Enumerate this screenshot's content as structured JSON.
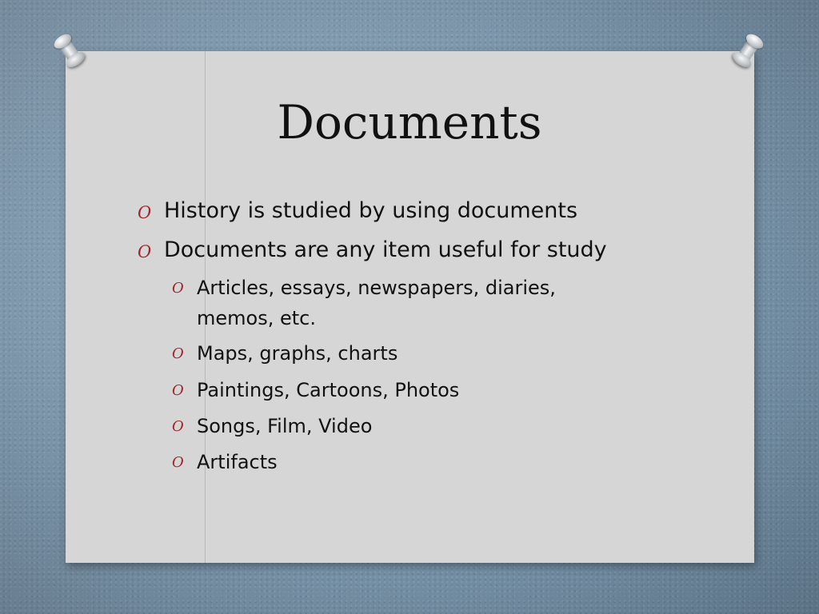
{
  "slide": {
    "title": "Documents",
    "bullets": [
      "History is studied by using documents",
      "Documents are any item useful for study"
    ],
    "sub_bullets": [
      [
        "Articles, essays, newspapers, diaries,",
        "memos, etc."
      ],
      "Maps, graphs, charts",
      "Paintings, Cartoons, Photos",
      "Songs, Film, Video",
      "Artifacts"
    ],
    "marker": "O"
  },
  "colors": {
    "background": "#7d98ae",
    "card": "#d6d6d6",
    "marker": "#a1262a",
    "text": "#111111"
  }
}
